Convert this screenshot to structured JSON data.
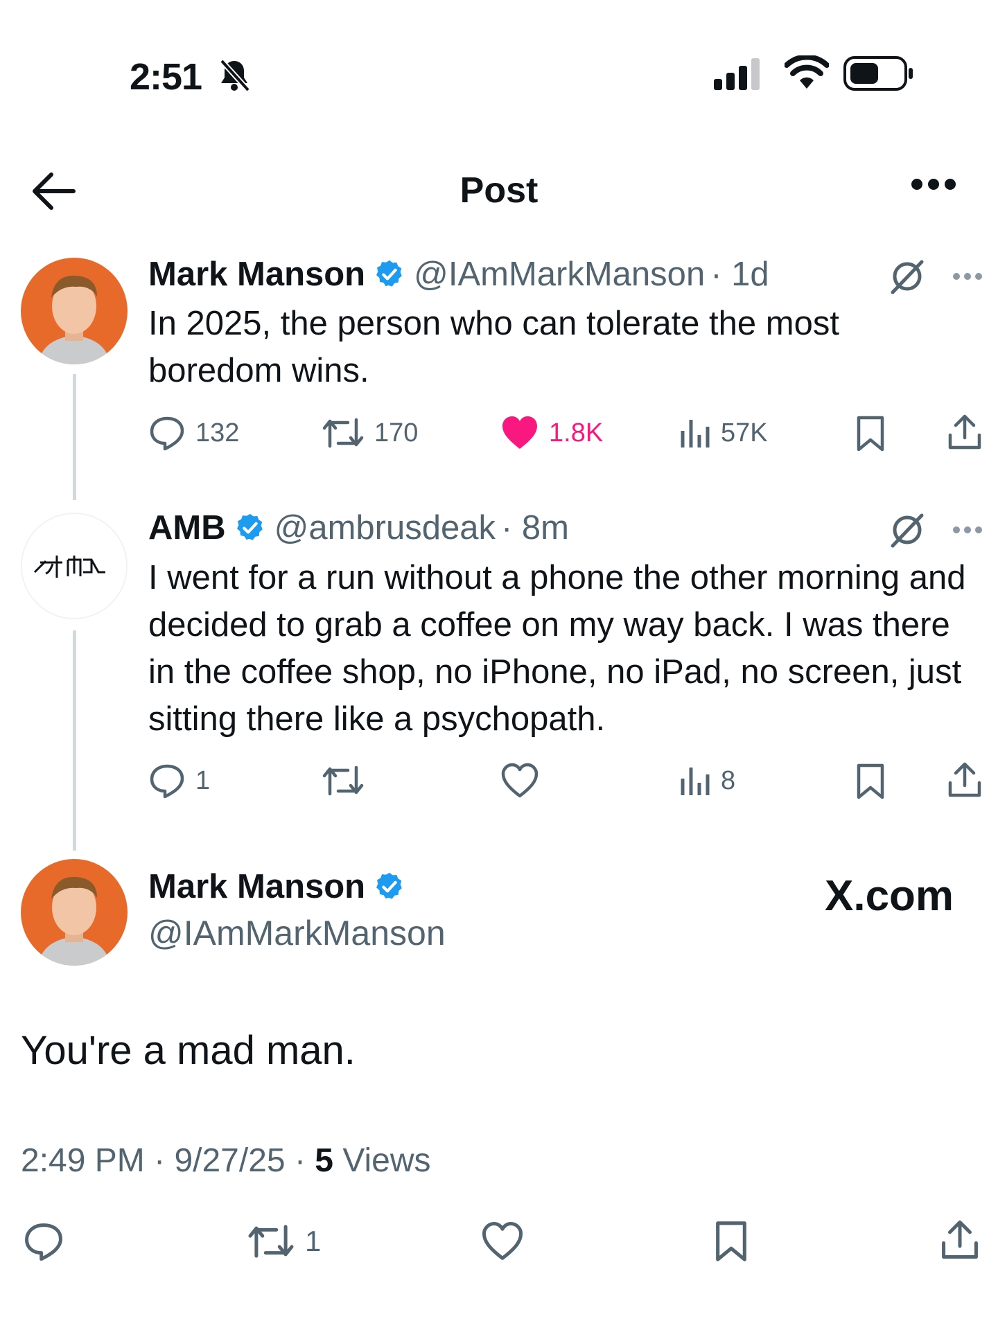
{
  "status_bar": {
    "time": "2:51"
  },
  "header": {
    "title": "Post"
  },
  "tweets": [
    {
      "name": "Mark Manson",
      "handle": "@IAmMarkManson",
      "time": "· 1d",
      "text": "In 2025, the person who can tolerate the most boredom wins.",
      "replies": "132",
      "retweets": "170",
      "likes": "1.8K",
      "views": "57K",
      "liked": true
    },
    {
      "name": "AMB",
      "handle": "@ambrusdeak",
      "time": "· 8m",
      "text": "I went for a run without a phone the other morning and decided to grab a coffee on my way back. I was there in the coffee shop, no iPhone, no iPad, no screen, just sitting there like a psychopath.",
      "replies": "1",
      "retweets": "",
      "likes": "",
      "views": "8",
      "liked": false
    }
  ],
  "main_post": {
    "name": "Mark Manson",
    "handle": "@IAmMarkManson",
    "text": "You're a mad man.",
    "time": "2:49 PM",
    "date": "9/27/25",
    "views_count": "5",
    "views_label": "Views",
    "retweets": "1"
  },
  "watermark": "X.com",
  "colors": {
    "verified": "#1d9bf0",
    "like_active": "#f91880",
    "secondary_text": "#536471",
    "avatar_bg": "#e86a2a"
  },
  "icons": [
    "bell-slash-icon",
    "signal-icon",
    "wifi-icon",
    "battery-icon",
    "back-arrow-icon",
    "more-icon",
    "grok-icon",
    "reply-icon",
    "retweet-icon",
    "heart-icon",
    "views-icon",
    "bookmark-icon",
    "share-icon",
    "verified-badge-icon"
  ]
}
